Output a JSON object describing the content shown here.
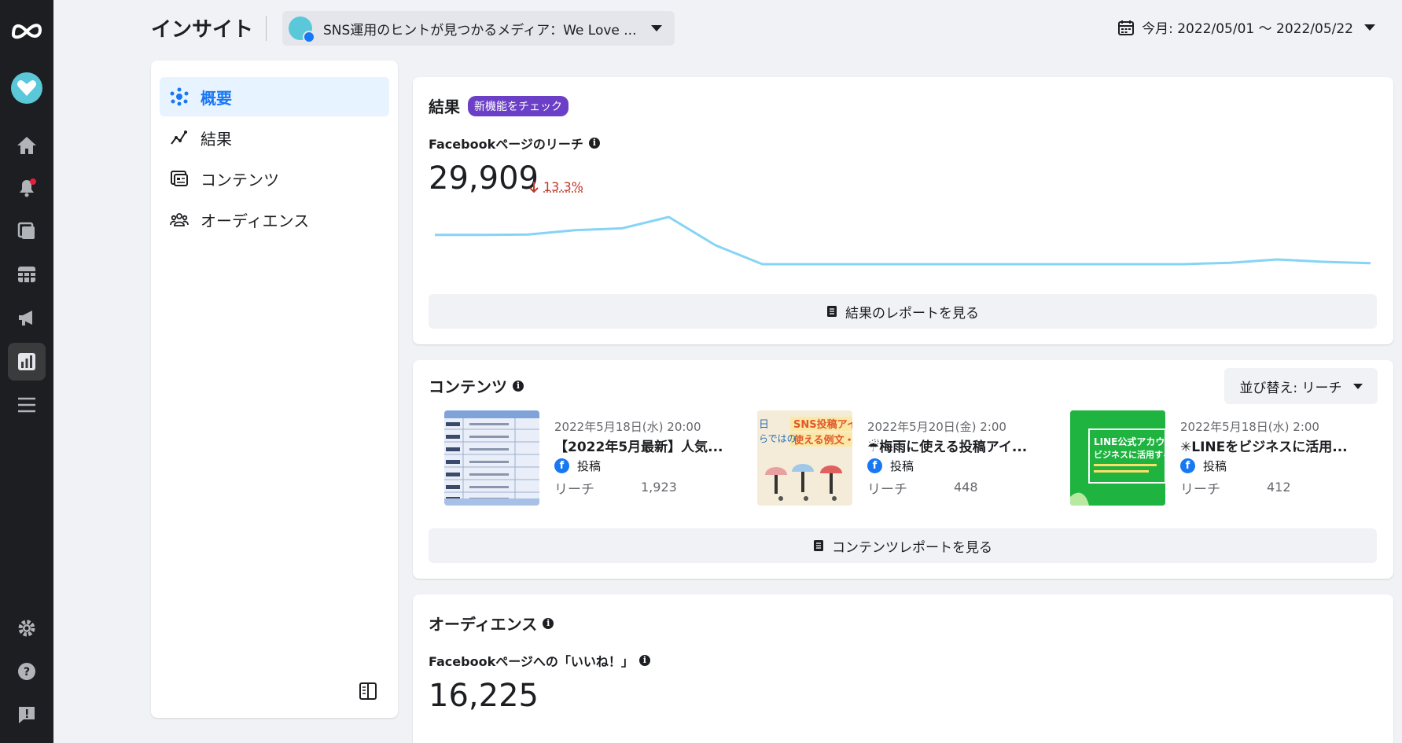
{
  "rail": {
    "items": [
      "meta-logo-icon",
      "page-avatar",
      "home-icon",
      "notifications-icon",
      "pages-icon",
      "calendar-grid-icon",
      "ads-megaphone-icon",
      "insights-chart-icon",
      "menu-icon",
      "settings-icon",
      "help-icon",
      "report-issue-icon"
    ],
    "active": "insights-chart-icon"
  },
  "header": {
    "title": "インサイト",
    "page_selector": "SNS運用のヒントが見つかるメディア：We Love ...",
    "date_range": "今月: 2022/05/01 ～ 2022/05/22"
  },
  "nav": {
    "items": [
      {
        "label": "概要",
        "icon": "overview-icon",
        "active": true
      },
      {
        "label": "結果",
        "icon": "results-icon",
        "active": false
      },
      {
        "label": "コンテンツ",
        "icon": "content-icon",
        "active": false
      },
      {
        "label": "オーディエンス",
        "icon": "audience-icon",
        "active": false
      }
    ]
  },
  "results": {
    "title": "結果",
    "badge": "新機能をチェック",
    "metric_label": "Facebookページのリーチ",
    "value": "29,909",
    "delta_pct": "13.3%",
    "delta_direction": "down",
    "report_button": "結果のレポートを見る",
    "sparkline": [
      0.62,
      0.62,
      0.63,
      0.72,
      0.76,
      1.0,
      0.4,
      0.0,
      0.0,
      0.0,
      0.0,
      0.0,
      0.0,
      0.0,
      0.0,
      0.0,
      0.0,
      0.03,
      0.1,
      0.05,
      0.02
    ]
  },
  "content": {
    "title": "コンテンツ",
    "sort_label": "並び替え: リーチ",
    "report_button": "コンテンツレポートを見る",
    "posts": [
      {
        "date": "2022年5月18日(水) 20:00",
        "title": "【2022年5月最新】人気...",
        "type": "投稿",
        "reach_label": "リーチ",
        "reach": "1,923"
      },
      {
        "date": "2022年5月20日(金) 2:00",
        "title": "☔梅雨に使える投稿アイ...",
        "type": "投稿",
        "reach_label": "リーチ",
        "reach": "448"
      },
      {
        "date": "2022年5月18日(水) 2:00",
        "title": "✳LINEをビジネスに活用...",
        "type": "投稿",
        "reach_label": "リーチ",
        "reach": "412"
      }
    ],
    "thumb2_text_a": "SNS投稿アイ",
    "thumb2_text_b": "使える例文・",
    "thumb2_text_c": "日",
    "thumb2_text_d": "らではの",
    "thumb3_text_a": "LINE公式アカウ",
    "thumb3_text_b": "ビジネスに活用する"
  },
  "audience": {
    "title": "オーディエンス",
    "metric_label": "Facebookページへの「いいね！」",
    "value": "16,225"
  },
  "colors": {
    "accent": "#1877f2",
    "sparkline": "#86d4f5",
    "badge": "#6b3fc6",
    "delta_down": "#c0392b",
    "rail": "#1c1e21"
  }
}
